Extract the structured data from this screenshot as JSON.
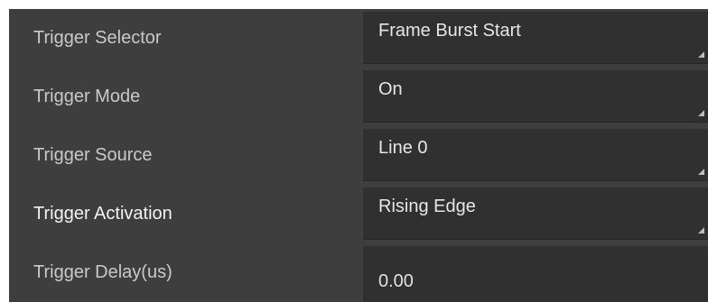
{
  "properties": [
    {
      "label": "Trigger Selector",
      "value": "Frame Burst Start",
      "control": "dropdown"
    },
    {
      "label": "Trigger Mode",
      "value": "On",
      "control": "dropdown"
    },
    {
      "label": "Trigger Source",
      "value": "Line 0",
      "control": "dropdown"
    },
    {
      "label": "Trigger Activation",
      "value": "Rising Edge",
      "control": "dropdown"
    },
    {
      "label": "Trigger Delay(us)",
      "value": "0.00",
      "control": "text"
    }
  ],
  "colors": {
    "panel_background": "#3e3e3e",
    "field_background": "#303030",
    "label_text": "#c9c9c9",
    "active_label_text": "#f2f2f2",
    "value_text": "#e6e6e6",
    "dropdown_arrow": "#bdbdbd"
  },
  "icons": {
    "dropdown": "chevron-down-icon"
  }
}
